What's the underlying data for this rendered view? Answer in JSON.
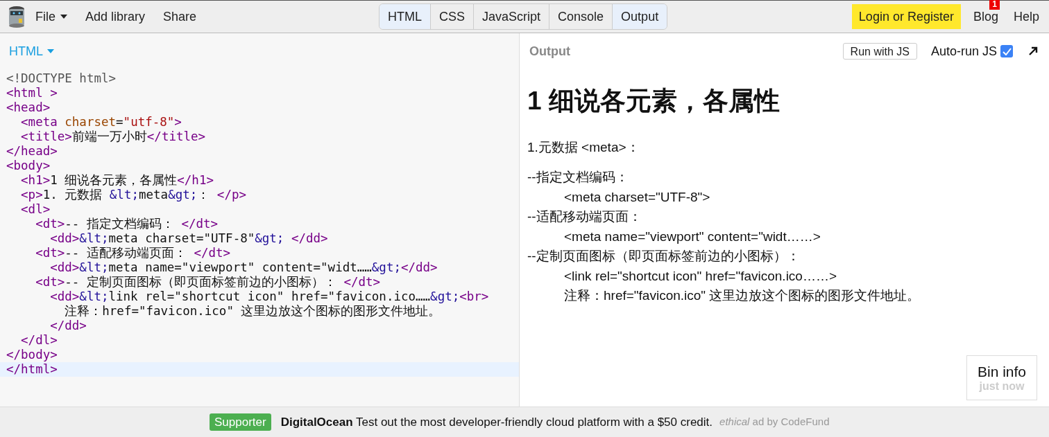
{
  "menu": [
    {
      "label": "File",
      "dropdown": true
    },
    {
      "label": "Add library",
      "dropdown": false
    },
    {
      "label": "Share",
      "dropdown": false
    }
  ],
  "panel_tabs": [
    {
      "label": "HTML",
      "selected": true
    },
    {
      "label": "CSS",
      "selected": false
    },
    {
      "label": "JavaScript",
      "selected": false
    },
    {
      "label": "Console",
      "selected": false
    },
    {
      "label": "Output",
      "selected": true
    }
  ],
  "login": "Login or Register",
  "right_links": [
    {
      "label": "Blog",
      "badge": "1"
    },
    {
      "label": "Help"
    }
  ],
  "editor": {
    "mode": "HTML",
    "lines": [
      {
        "current": false,
        "segments": [
          {
            "kind": "doctype",
            "text": "<!DOCTYPE html>"
          }
        ]
      },
      {
        "current": false,
        "segments": [
          {
            "kind": "tag",
            "text": "<html >"
          }
        ]
      },
      {
        "current": false,
        "segments": [
          {
            "kind": "tag",
            "text": "<head>"
          }
        ],
        "children": [
          {
            "current": false,
            "segments": [
              {
                "kind": "tag",
                "text": "<meta "
              },
              {
                "kind": "attr",
                "text": "charset"
              },
              {
                "kind": "text",
                "text": "="
              },
              {
                "kind": "string",
                "text": "\"utf-8\""
              },
              {
                "kind": "tag",
                "text": ">"
              }
            ]
          },
          {
            "current": false,
            "segments": [
              {
                "kind": "tag",
                "text": "<title>"
              },
              {
                "kind": "text",
                "text": "前端一万小时"
              },
              {
                "kind": "tag",
                "text": "</title>"
              }
            ]
          }
        ]
      },
      {
        "current": false,
        "segments": [
          {
            "kind": "tag",
            "text": "</head>"
          }
        ]
      },
      {
        "current": false,
        "segments": [
          {
            "kind": "tag",
            "text": "<body>"
          }
        ],
        "children": [
          {
            "current": false,
            "segments": [
              {
                "kind": "tag",
                "text": "<h1>"
              },
              {
                "kind": "text",
                "text": "1 细说各元素，各属性"
              },
              {
                "kind": "tag",
                "text": "</h1>"
              }
            ]
          },
          {
            "current": false,
            "segments": [
              {
                "kind": "tag",
                "text": "<p>"
              },
              {
                "kind": "text",
                "text": "1. 元数据 "
              },
              {
                "kind": "entity",
                "text": "&lt;"
              },
              {
                "kind": "text",
                "text": "meta"
              },
              {
                "kind": "entity",
                "text": "&gt;"
              },
              {
                "kind": "text",
                "text": "： "
              },
              {
                "kind": "tag",
                "text": "</p>"
              }
            ]
          },
          {
            "current": false,
            "segments": [
              {
                "kind": "tag",
                "text": "<dl>"
              }
            ],
            "children": [
              {
                "current": false,
                "segments": [
                  {
                    "kind": "tag",
                    "text": "<dt>"
                  },
                  {
                    "kind": "text",
                    "text": "-- 指定文档编码： "
                  },
                  {
                    "kind": "tag",
                    "text": "</dt>"
                  }
                ],
                "children": [
                  {
                    "current": false,
                    "segments": [
                      {
                        "kind": "tag",
                        "text": "<dd>"
                      },
                      {
                        "kind": "entity",
                        "text": "&lt;"
                      },
                      {
                        "kind": "text",
                        "text": "meta charset=\"UTF-8\""
                      },
                      {
                        "kind": "entity",
                        "text": "&gt;"
                      },
                      {
                        "kind": "tag",
                        "text": " </dd>"
                      }
                    ]
                  }
                ]
              },
              {
                "current": false,
                "segments": [
                  {
                    "kind": "tag",
                    "text": "<dt>"
                  },
                  {
                    "kind": "text",
                    "text": "-- 适配移动端页面： "
                  },
                  {
                    "kind": "tag",
                    "text": "</dt>"
                  }
                ],
                "children": [
                  {
                    "current": false,
                    "segments": [
                      {
                        "kind": "tag",
                        "text": "<dd>"
                      },
                      {
                        "kind": "entity",
                        "text": "&lt;"
                      },
                      {
                        "kind": "text",
                        "text": "meta name=\"viewport\" content=\"widt……"
                      },
                      {
                        "kind": "entity",
                        "text": "&gt;"
                      },
                      {
                        "kind": "tag",
                        "text": "</dd>"
                      }
                    ]
                  }
                ]
              },
              {
                "current": false,
                "segments": [
                  {
                    "kind": "tag",
                    "text": "<dt>"
                  },
                  {
                    "kind": "text",
                    "text": "-- 定制页面图标（即页面标签前边的小图标）： "
                  },
                  {
                    "kind": "tag",
                    "text": "</dt>"
                  }
                ],
                "children": [
                  {
                    "current": false,
                    "segments": [
                      {
                        "kind": "tag",
                        "text": "<dd>"
                      },
                      {
                        "kind": "entity",
                        "text": "&lt;"
                      },
                      {
                        "kind": "text",
                        "text": "link rel=\"shortcut icon\" href=\"favicon.ico……"
                      },
                      {
                        "kind": "entity",
                        "text": "&gt;"
                      },
                      {
                        "kind": "tag",
                        "text": "<br>"
                      }
                    ],
                    "children": [
                      {
                        "current": false,
                        "segments": [
                          {
                            "kind": "text",
                            "text": "注释：href=\"favicon.ico\" 这里边放这个图标的图形文件地址。"
                          }
                        ]
                      }
                    ]
                  },
                  {
                    "current": false,
                    "segments": [
                      {
                        "kind": "tag",
                        "text": "</dd>"
                      }
                    ]
                  }
                ]
              }
            ]
          },
          {
            "current": false,
            "segments": [
              {
                "kind": "tag",
                "text": "</dl>"
              }
            ]
          }
        ]
      },
      {
        "current": false,
        "segments": [
          {
            "kind": "tag",
            "text": "</body>"
          }
        ]
      },
      {
        "current": true,
        "segments": [
          {
            "kind": "tag",
            "text": "</html>"
          }
        ]
      }
    ]
  },
  "output": {
    "title": "Output",
    "run_button": "Run with JS",
    "autorun": {
      "label": "Auto-run JS",
      "checked": true
    },
    "content": [
      {
        "kind": "h1",
        "text": "1 细说各元素，各属性"
      },
      {
        "kind": "p",
        "text": "1.元数据 <meta>："
      },
      {
        "kind": "dt",
        "text": "--指定文档编码："
      },
      {
        "kind": "dd",
        "text": "<meta charset=\"UTF-8\">"
      },
      {
        "kind": "dt",
        "text": "--适配移动端页面："
      },
      {
        "kind": "dd",
        "text": "<meta name=\"viewport\" content=\"widt……>"
      },
      {
        "kind": "dt",
        "text": "--定制页面图标（即页面标签前边的小图标）："
      },
      {
        "kind": "dd",
        "text": "<link rel=\"shortcut icon\" href=\"favicon.ico……>"
      },
      {
        "kind": "dd",
        "text": "注释：href=\"favicon.ico\" 这里边放这个图标的图形文件地址。"
      }
    ],
    "bin_info": {
      "title": "Bin info",
      "time": "just now"
    }
  },
  "footer": {
    "badge": "Supporter",
    "sponsor": "DigitalOcean",
    "message": "Test out the most developer-friendly cloud platform with a $50 credit.",
    "ethical": "ethical",
    "by": "ad by CodeFund"
  }
}
